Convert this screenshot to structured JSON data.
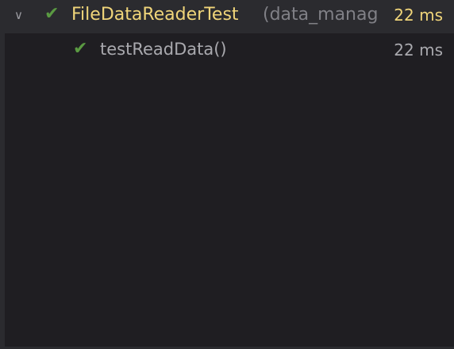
{
  "suite": {
    "name": "FileDataReaderTest",
    "package": "(data_manag",
    "time": "22 ms",
    "status": "passed",
    "expanded": true
  },
  "tests": [
    {
      "name": "testReadData()",
      "time": "22 ms",
      "status": "passed"
    }
  ],
  "colors": {
    "pass": "#5a9a42",
    "suite_text": "#f0d57a",
    "test_text": "#a9a9ae",
    "background": "#1f1e22"
  }
}
